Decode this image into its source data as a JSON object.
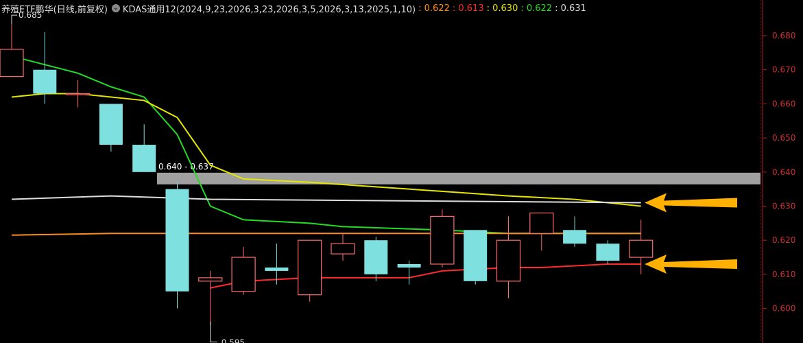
{
  "header": {
    "title": "养殖ETF鹏华(日线,前复权)",
    "indicator": "KDAS通用12(2024,9,23,2026,3,23,2026,3,5,2026,3,13,2025,1,10)",
    "values": [
      {
        "text": ": 0.622",
        "color": "#ff8c1a"
      },
      {
        "text": ": 0.613",
        "color": "#ff2a2a"
      },
      {
        "text": ": 0.630",
        "color": "#e6e600"
      },
      {
        "text": ": 0.622",
        "color": "#22dd22"
      },
      {
        "text": ": 0.631",
        "color": "#dddddd"
      }
    ]
  },
  "chart_data": {
    "type": "candlestick",
    "ylim": [
      0.595,
      0.684
    ],
    "yticks": [
      "0.680",
      "0.670",
      "0.660",
      "0.650",
      "0.640",
      "0.630",
      "0.620",
      "0.610",
      "0.600"
    ],
    "candles": [
      {
        "o": 0.668,
        "h": 0.685,
        "l": 0.668,
        "c": 0.676
      },
      {
        "o": 0.67,
        "h": 0.681,
        "l": 0.66,
        "c": 0.663
      },
      {
        "o": 0.663,
        "h": 0.667,
        "l": 0.659,
        "c": 0.663
      },
      {
        "o": 0.66,
        "h": 0.66,
        "l": 0.646,
        "c": 0.648
      },
      {
        "o": 0.648,
        "h": 0.654,
        "l": 0.64,
        "c": 0.64
      },
      {
        "o": 0.635,
        "h": 0.637,
        "l": 0.6,
        "c": 0.605
      },
      {
        "o": 0.608,
        "h": 0.611,
        "l": 0.595,
        "c": 0.609
      },
      {
        "o": 0.605,
        "h": 0.618,
        "l": 0.604,
        "c": 0.615
      },
      {
        "o": 0.612,
        "h": 0.619,
        "l": 0.607,
        "c": 0.611
      },
      {
        "o": 0.604,
        "h": 0.62,
        "l": 0.602,
        "c": 0.62
      },
      {
        "o": 0.616,
        "h": 0.622,
        "l": 0.614,
        "c": 0.619
      },
      {
        "o": 0.62,
        "h": 0.621,
        "l": 0.608,
        "c": 0.61
      },
      {
        "o": 0.613,
        "h": 0.614,
        "l": 0.607,
        "c": 0.612
      },
      {
        "o": 0.613,
        "h": 0.629,
        "l": 0.612,
        "c": 0.627
      },
      {
        "o": 0.623,
        "h": 0.623,
        "l": 0.607,
        "c": 0.608
      },
      {
        "o": 0.608,
        "h": 0.627,
        "l": 0.603,
        "c": 0.62
      },
      {
        "o": 0.622,
        "h": 0.628,
        "l": 0.617,
        "c": 0.628
      },
      {
        "o": 0.623,
        "h": 0.627,
        "l": 0.618,
        "c": 0.619
      },
      {
        "o": 0.619,
        "h": 0.62,
        "l": 0.613,
        "c": 0.614
      },
      {
        "o": 0.615,
        "h": 0.626,
        "l": 0.61,
        "c": 0.62
      }
    ],
    "series": [
      {
        "color": "#22dd22",
        "points": [
          [
            0,
            0.674
          ],
          [
            2,
            0.669
          ],
          [
            3,
            0.665
          ],
          [
            4,
            0.662
          ],
          [
            5,
            0.651
          ],
          [
            6,
            0.63
          ],
          [
            7,
            0.626
          ],
          [
            9,
            0.625
          ],
          [
            10,
            0.624
          ],
          [
            13,
            0.623
          ],
          [
            15,
            0.622
          ],
          [
            19,
            0.622
          ]
        ]
      },
      {
        "color": "#e6e600",
        "points": [
          [
            0,
            0.662
          ],
          [
            1,
            0.663
          ],
          [
            2,
            0.663
          ],
          [
            4,
            0.661
          ],
          [
            5,
            0.656
          ],
          [
            6,
            0.642
          ],
          [
            7,
            0.638
          ],
          [
            9,
            0.637
          ],
          [
            12,
            0.635
          ],
          [
            15,
            0.633
          ],
          [
            17,
            0.632
          ],
          [
            19,
            0.63
          ]
        ]
      },
      {
        "color": "#dddddd",
        "points": [
          [
            0,
            0.632
          ],
          [
            3,
            0.633
          ],
          [
            6,
            0.632
          ],
          [
            19,
            0.631
          ]
        ]
      },
      {
        "color": "#ff8c1a",
        "points": [
          [
            0,
            0.6215
          ],
          [
            3,
            0.622
          ],
          [
            7,
            0.622
          ],
          [
            19,
            0.622
          ]
        ]
      },
      {
        "color": "#ff2a2a",
        "points": [
          [
            6,
            0.606
          ],
          [
            7,
            0.608
          ],
          [
            9,
            0.609
          ],
          [
            12,
            0.609
          ],
          [
            13,
            0.611
          ],
          [
            15,
            0.612
          ],
          [
            16,
            0.612
          ],
          [
            18,
            0.613
          ],
          [
            19,
            0.613
          ]
        ]
      }
    ],
    "zone": {
      "label": "0.640 - 0.637",
      "high": 0.64,
      "low": 0.637
    },
    "annotations": [
      {
        "text": "0.685",
        "idx": 0,
        "value": 0.685,
        "pos": "top"
      },
      {
        "text": "0.595",
        "idx": 6,
        "value": 0.595,
        "pos": "bottom"
      }
    ],
    "arrows": [
      {
        "target": 0.631,
        "color": "#ffb000"
      },
      {
        "target": 0.613,
        "color": "#ffb000"
      }
    ],
    "up_color": "#ff6b6b",
    "down_color": "#7fe0e0"
  }
}
